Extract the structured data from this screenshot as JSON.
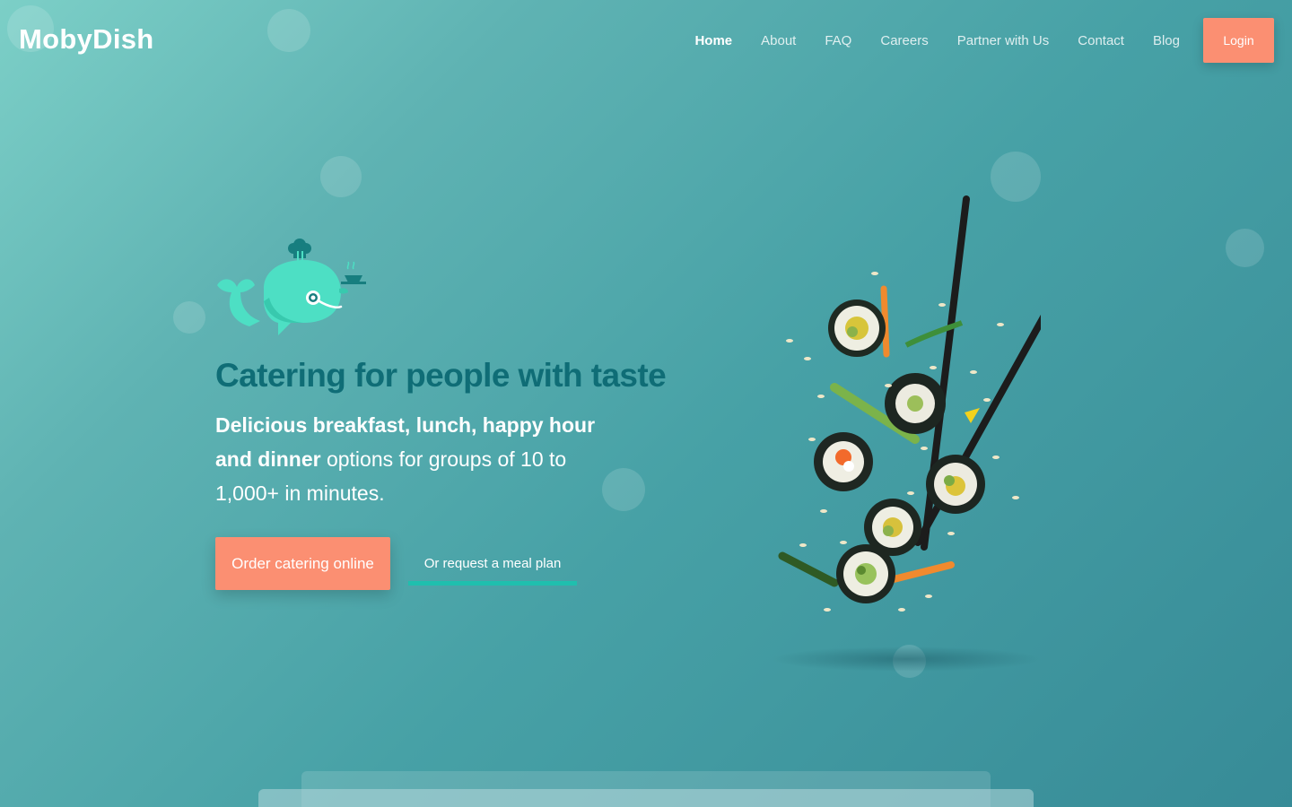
{
  "brand": {
    "name": "MobyDish"
  },
  "nav": {
    "items": [
      {
        "label": "Home",
        "active": true
      },
      {
        "label": "About",
        "active": false
      },
      {
        "label": "FAQ",
        "active": false
      },
      {
        "label": "Careers",
        "active": false
      },
      {
        "label": "Partner with Us",
        "active": false
      },
      {
        "label": "Contact",
        "active": false
      },
      {
        "label": "Blog",
        "active": false
      }
    ],
    "login_label": "Login"
  },
  "hero": {
    "headline": "Catering for people with taste",
    "subtext_bold": "Delicious breakfast, lunch, happy hour and dinner",
    "subtext_rest": " options for groups of 10 to 1,000+ in minutes.",
    "primary_cta": "Order catering online",
    "secondary_cta": "Or request a meal plan",
    "mascot_icon": "whale-chef-icon",
    "hero_image_icon": "sushi-chopsticks-icon"
  },
  "colors": {
    "accent": "#fb8f72",
    "headline": "#0f6d76",
    "underline": "#1fbfae",
    "whale": "#4ddfc4",
    "whale_dark": "#177e7f"
  }
}
